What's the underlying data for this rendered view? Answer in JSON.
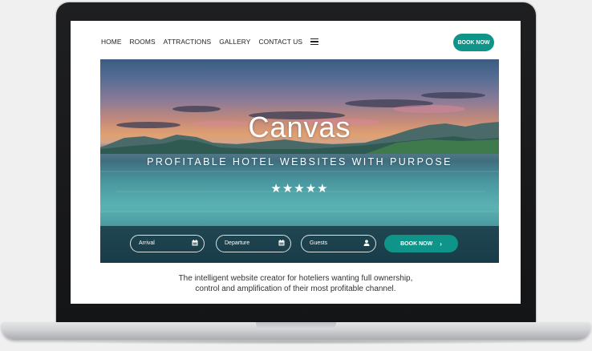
{
  "nav": {
    "links": [
      "HOME",
      "ROOMS",
      "ATTRACTIONS",
      "GALLERY",
      "CONTACT US"
    ],
    "menu_icon": "hamburger-icon",
    "book_button": "BOOK NOW"
  },
  "hero": {
    "title": "Canvas",
    "subtitle": "PROFITABLE HOTEL WEBSITES WITH PURPOSE",
    "stars": "★★★★★"
  },
  "booking": {
    "arrival_label": "Arrival",
    "departure_label": "Departure",
    "guests_label": "Guests",
    "book_button": "BOOK NOW",
    "book_chevron": "›"
  },
  "tagline": {
    "line1": "The intelligent website creator for hoteliers wanting full ownership,",
    "line2": "control and amplification of their most profitable channel."
  },
  "colors": {
    "accent": "#0e9488",
    "booking_bar": "#14303c",
    "frame": "#1a1b1d"
  }
}
